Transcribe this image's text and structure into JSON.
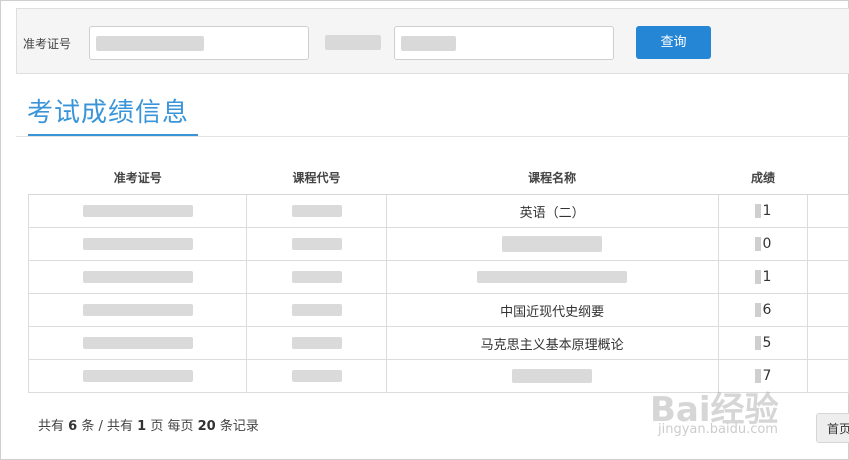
{
  "search": {
    "ticket_label": "准考证号",
    "query_button": "查询"
  },
  "section_title": "考试成绩信息",
  "table": {
    "headers": [
      "准考证号",
      "课程代号",
      "课程名称",
      "成绩"
    ],
    "rows": [
      {
        "course_name": "英语（二）",
        "score": "1"
      },
      {
        "course_name": "",
        "score": "0"
      },
      {
        "course_name": "",
        "score": "1"
      },
      {
        "course_name": "中国近现代史纲要",
        "score": "6"
      },
      {
        "course_name": "马克思主义基本原理概论",
        "score": "5"
      },
      {
        "course_name": "",
        "score": "7"
      }
    ]
  },
  "pagination": {
    "prefix": "共有",
    "total_items": "6",
    "items_unit": "条 / 共有",
    "total_pages": "1",
    "pages_unit": "页 每页",
    "per_page": "20",
    "per_page_unit": "条记录",
    "first_button": "首页"
  },
  "watermark": {
    "brand": "Bai经验",
    "url": "jingyan.baidu.com"
  }
}
